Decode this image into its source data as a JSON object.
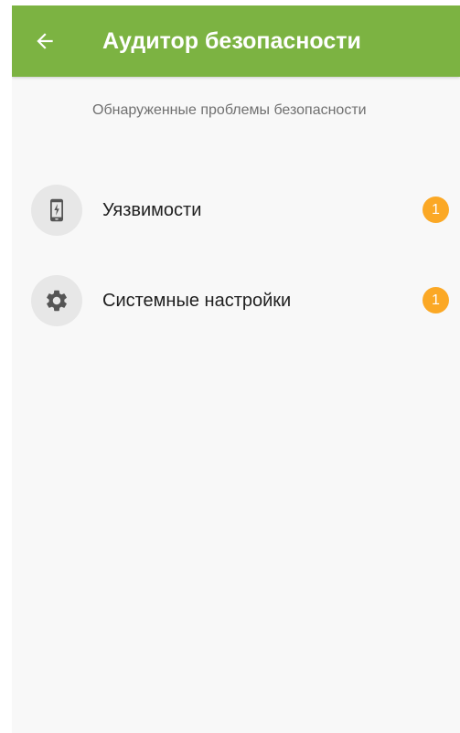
{
  "colors": {
    "appbar": "#7cb342",
    "badge": "#fba825",
    "icon": "#555555"
  },
  "header": {
    "title": "Аудитор безопасности",
    "back_icon": "arrow-back-icon"
  },
  "main": {
    "subtitle": "Обнаруженные проблемы безопасности",
    "items": [
      {
        "label": "Уязвимости",
        "icon": "phone-warning-icon",
        "badge": "1"
      },
      {
        "label": "Системные настройки",
        "icon": "gear-icon",
        "badge": "1"
      }
    ]
  }
}
